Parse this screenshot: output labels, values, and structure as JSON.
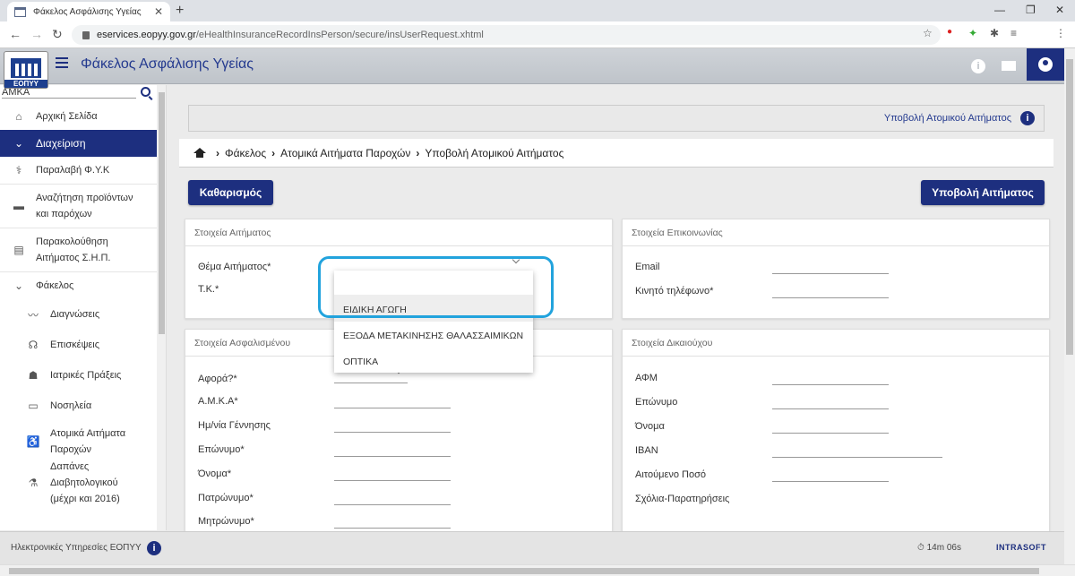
{
  "browser": {
    "tab_title": "Φάκελος Ασφάλισης Υγείας",
    "url_host": "eservices.eopyy.gov.gr",
    "url_path": "/eHealthInsuranceRecordInsPerson/secure/insUserRequest.xhtml"
  },
  "header": {
    "logo_text": "ΕΟΠΥΥ",
    "title": "Φάκελος Ασφάλισης Υγείας"
  },
  "sidebar": {
    "search_placeholder": "ΑΜΚΑ",
    "items": [
      {
        "label": "Αρχική Σελίδα",
        "icon": "home-icon",
        "glyph": "⌂"
      },
      {
        "label": "Διαχείριση",
        "icon": "chevron-down-icon",
        "glyph": "⌄"
      },
      {
        "label": "Παραλαβή Φ.Υ.Κ",
        "icon": "pill-icon",
        "glyph": "⚕"
      },
      {
        "label1": "Αναζήτηση προϊόντων",
        "label2": "και παρόχων",
        "icon": "folder-open-icon",
        "glyph": "▬"
      },
      {
        "label1": "Παρακολούθηση",
        "label2": "Αιτήματος Σ.Η.Π.",
        "icon": "document-icon",
        "glyph": "▤"
      },
      {
        "label": "Φάκελος",
        "icon": "chevron-down-icon",
        "glyph": "⌄"
      },
      {
        "label": "Διαγνώσεις",
        "icon": "heartbeat-icon",
        "glyph": "〰"
      },
      {
        "label": "Επισκέψεις",
        "icon": "stethoscope-icon",
        "glyph": "☊"
      },
      {
        "label": "Ιατρικές Πράξεις",
        "icon": "doctor-icon",
        "glyph": "☗"
      },
      {
        "label": "Νοσηλεία",
        "icon": "bed-icon",
        "glyph": "▭"
      },
      {
        "label1": "Ατομικά Αιτήματα",
        "label2": "Παροχών",
        "icon": "wheelchair-icon",
        "glyph": "♿"
      },
      {
        "label1": "Δαπάνες Διαβητολογικού",
        "label2": "(μέχρι και 2016)",
        "icon": "diabetes-icon",
        "glyph": "⚗"
      }
    ]
  },
  "page": {
    "title": "Υποβολή Ατομικού Αιτήματος",
    "breadcrumb": [
      "Φάκελος",
      "Ατομικά Αιτήματα Παροχών",
      "Υποβολή Ατομικού Αιτήματος"
    ],
    "clear_button": "Καθαρισμός",
    "submit_button": "Υποβολή Αιτήματος"
  },
  "request_panel": {
    "title": "Στοιχεία Αιτήματος",
    "subject_label": "Θέμα Αιτήματος*",
    "postal_label": "Τ.Κ.*"
  },
  "contact_panel": {
    "title": "Στοιχεία Επικοινωνίας",
    "email_label": "Email",
    "mobile_label": "Κινητό τηλέφωνο*"
  },
  "insured_panel": {
    "title": "Στοιχεία Ασφαλισμένου",
    "fields": [
      "Αφορά?*",
      "Α.Μ.Κ.Α*",
      "Ημ/νία Γέννησης",
      "Επώνυμο*",
      "Όνομα*",
      "Πατρώνυμο*",
      "Μητρώνυμο*"
    ]
  },
  "beneficiary_panel": {
    "title": "Στοιχεία Δικαιούχου",
    "fields": [
      "ΑΦΜ",
      "Επώνυμο",
      "Όνομα",
      "IBAN",
      "Αιτούμενο Ποσό",
      "Σχόλια-Παρατηρήσεις"
    ]
  },
  "dropdown": {
    "options": [
      "ΕΙΔΙΚΗ ΑΓΩΓΗ",
      "ΕΞΟΔΑ ΜΕΤΑΚΙΝΗΣΗΣ ΘΑΛΑΣΣΑΙΜΙΚΩΝ",
      "ΟΠΤΙΚΑ"
    ],
    "highlighted_index": 0
  },
  "footer": {
    "text": "Ηλεκτρονικές Υπηρεσίες ΕΟΠΥΥ",
    "timer": "14m 06s",
    "brand": "INTRASOFT"
  },
  "colors": {
    "primary": "#1d2f7f",
    "highlight_ring": "#22a3dd"
  }
}
